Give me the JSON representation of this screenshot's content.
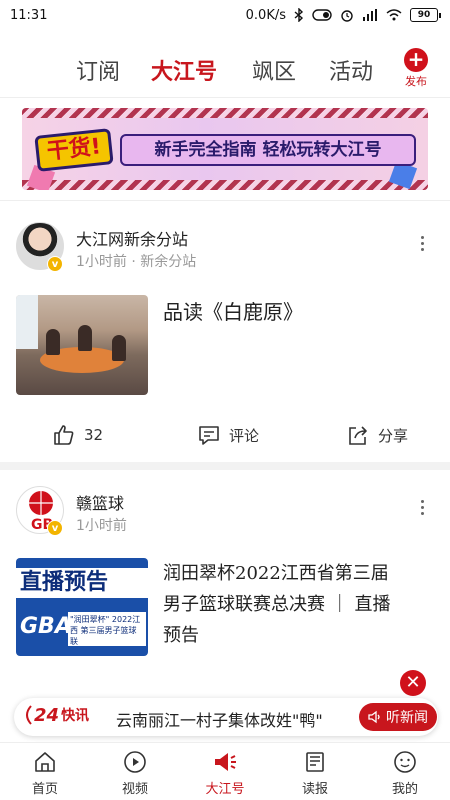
{
  "status_bar": {
    "time": "11:31",
    "network_speed": "0.0K/s",
    "battery": "90"
  },
  "top_tabs": {
    "items": [
      "订阅",
      "大江号",
      "飒区",
      "活动"
    ],
    "active": "大江号",
    "publish_label": "发布"
  },
  "banner": {
    "badge": "干货!",
    "text": "新手完全指南 轻松玩转大江号"
  },
  "posts": [
    {
      "author": "大江网新余分站",
      "meta": "1小时前 · 新余分站",
      "verified_icon": "v-badge-icon",
      "title": "品读《白鹿原》",
      "likes": "32",
      "comment_label": "评论",
      "share_label": "分享"
    },
    {
      "author": "赣篮球",
      "meta": "1小时前",
      "avatar_text": "GB",
      "verified_icon": "v-badge-icon",
      "title_line1": "润田翠杯2022江西省第三届",
      "title_line2": "男子篮球联赛总决赛 ｜ 直播",
      "title_line3": "预告",
      "thumb_live": "直播预告",
      "thumb_gba": "GBA",
      "thumb_sub": "\"润田翠杯\" 2022江西 第三届男子篮球联"
    }
  ],
  "news_ticker": {
    "logo_num": "24",
    "logo_text": "快讯",
    "text": "云南丽江一村子集体改姓\"鸭\"",
    "listen_label": "听新闻"
  },
  "bottom_nav": {
    "items": [
      "首页",
      "视频",
      "大江号",
      "读报",
      "我的"
    ],
    "active": "大江号"
  },
  "colors": {
    "accent": "#c8161d",
    "ticker_button": "#c8161d",
    "badge_yellow": "#f3b400"
  }
}
